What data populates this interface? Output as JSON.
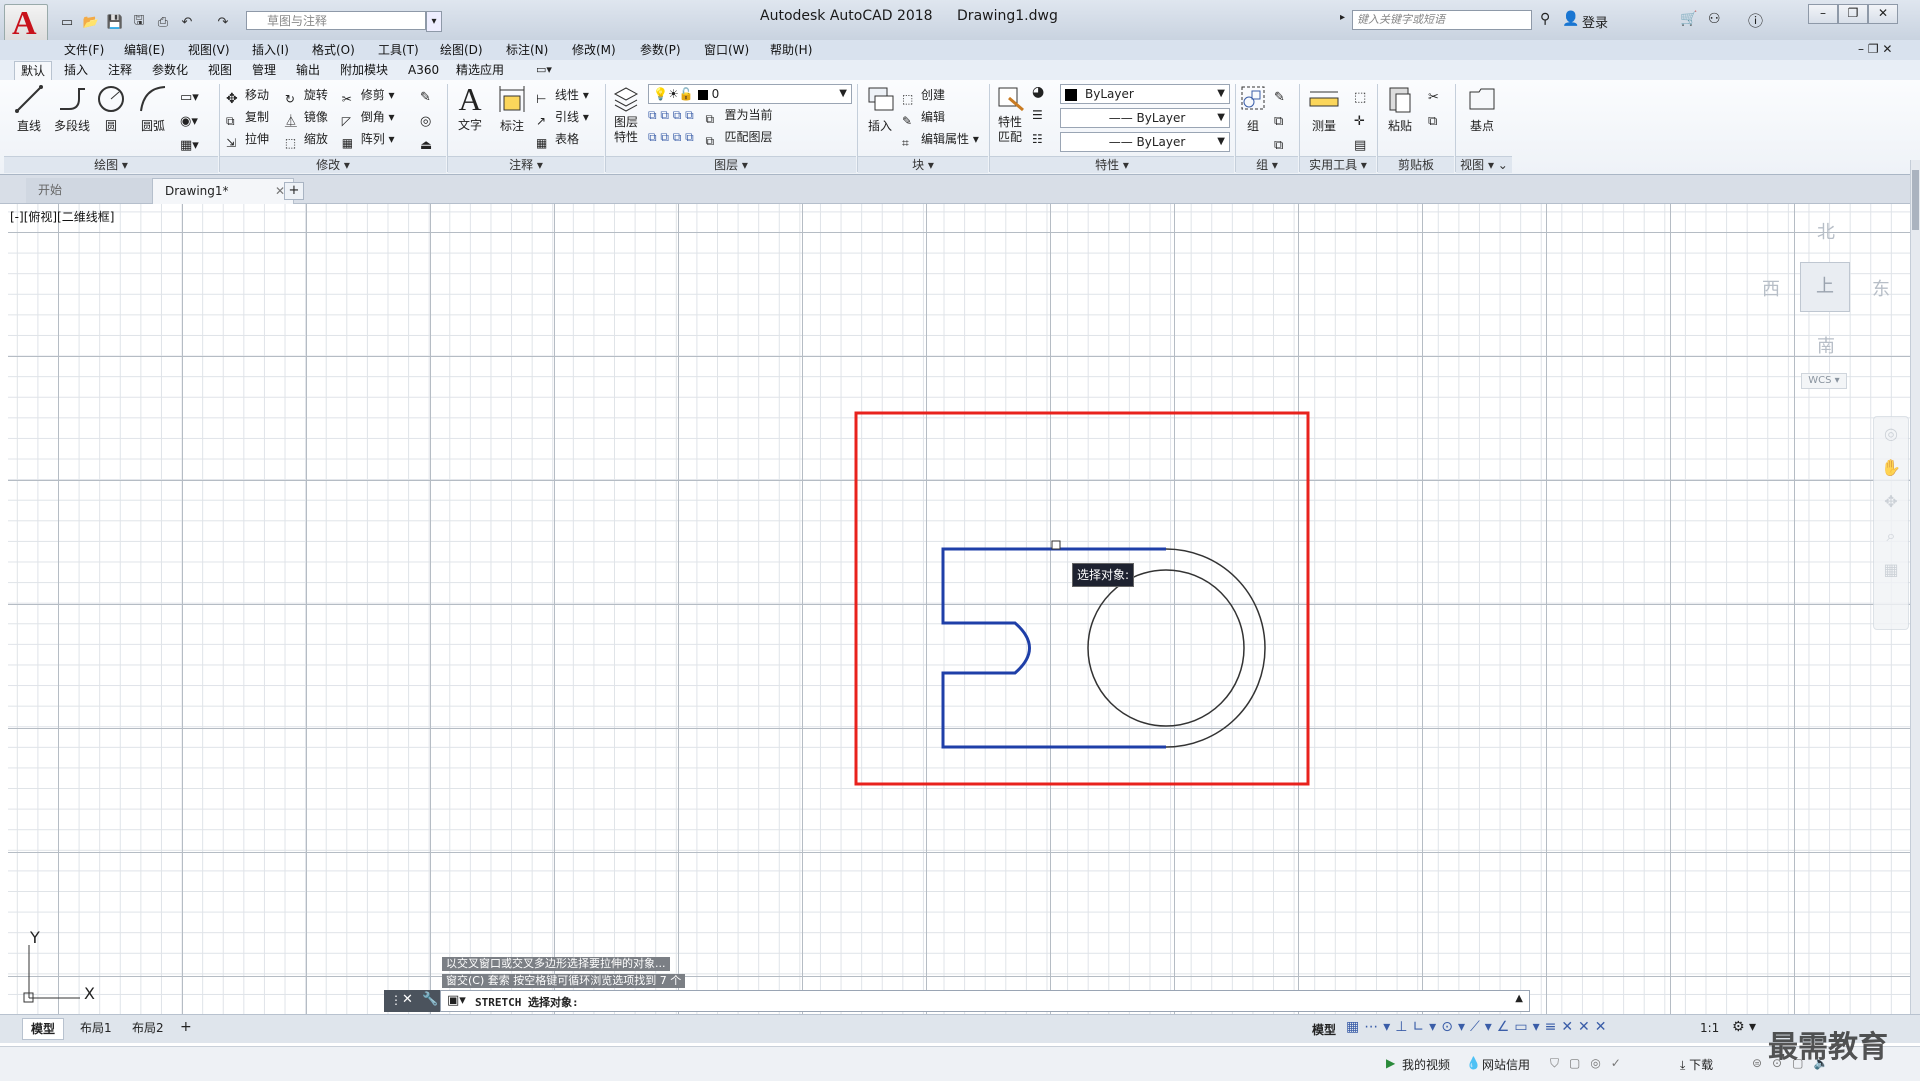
{
  "titlebar": {
    "app_title": "Autodesk AutoCAD 2018",
    "file_name": "Drawing1.dwg",
    "workspace": "草图与注释",
    "search_placeholder": "键入关键字或短语",
    "login": "登录"
  },
  "menubar": [
    "文件(F)",
    "编辑(E)",
    "视图(V)",
    "插入(I)",
    "格式(O)",
    "工具(T)",
    "绘图(D)",
    "标注(N)",
    "修改(M)",
    "参数(P)",
    "窗口(W)",
    "帮助(H)"
  ],
  "ribbon_tabs": [
    "默认",
    "插入",
    "注释",
    "参数化",
    "视图",
    "管理",
    "输出",
    "附加模块",
    "A360",
    "精选应用"
  ],
  "ribbon": {
    "draw": {
      "title": "绘图",
      "items": [
        "直线",
        "多段线",
        "圆",
        "圆弧"
      ]
    },
    "modify": {
      "title": "修改",
      "rows": [
        [
          "移动",
          "旋转",
          "修剪"
        ],
        [
          "复制",
          "镜像",
          "倒角"
        ],
        [
          "拉伸",
          "缩放",
          "阵列"
        ]
      ]
    },
    "annotation": {
      "title": "注释",
      "big": [
        "文字",
        "标注"
      ],
      "small": [
        "线性",
        "引线",
        "表格"
      ]
    },
    "layers": {
      "title": "图层",
      "big": "图层\n特性",
      "layer_value": "0",
      "small": [
        "置为当前",
        "匹配图层"
      ]
    },
    "block": {
      "title": "块",
      "big": "插入",
      "small": [
        "创建",
        "编辑",
        "编辑属性"
      ]
    },
    "properties": {
      "title": "特性",
      "big": "特性\n匹配",
      "values": [
        "ByLayer",
        "ByLayer",
        "ByLayer"
      ]
    },
    "groups": {
      "title": "组",
      "big": "组"
    },
    "utilities": {
      "title": "实用工具",
      "big": "测量"
    },
    "clipboard": {
      "title": "剪贴板",
      "big": "粘贴"
    },
    "view": {
      "title": "视图",
      "big": "基点"
    }
  },
  "file_tabs": {
    "start": "开始",
    "current": "Drawing1*"
  },
  "viewport_label": "[-][俯视][二维线框]",
  "viewcube": {
    "north": "北",
    "south": "南",
    "east": "东",
    "west": "西",
    "top_face": "上",
    "wcs": "WCS"
  },
  "tooltip": "选择对象:",
  "command": {
    "history": [
      "以交叉窗口或交叉多边形选择要拉伸的对象...",
      "窗交(C) 套索  按空格键可循环浏览选项找到 7 个"
    ],
    "prompt": "STRETCH 选择对象:"
  },
  "ucs": {
    "x": "X",
    "y": "Y"
  },
  "layout_tabs": [
    "模型",
    "布局1",
    "布局2"
  ],
  "status": {
    "model": "模型",
    "scale": "1:1"
  },
  "bottom_bar": {
    "video": "我的视频",
    "web": "网站信用",
    "download": "下载"
  },
  "watermark": "最需教育",
  "colors": {
    "selection_red": "#e8221d",
    "stretch_blue": "#1f3fa8",
    "accent": "#c8121b"
  }
}
